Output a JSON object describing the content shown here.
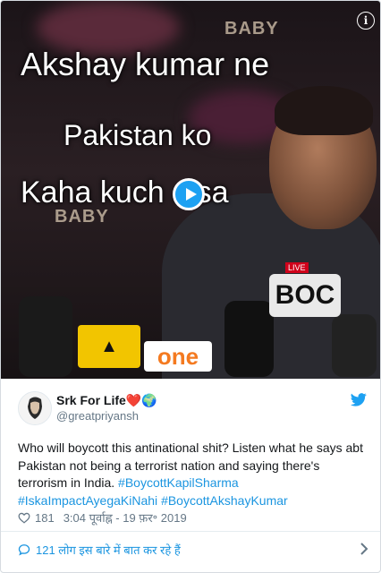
{
  "media": {
    "overlay_lines": [
      "Akshay kumar ne",
      "Pakistan ko",
      "Kaha kuch aisa"
    ],
    "background_labels": [
      "BABY",
      "BABY"
    ],
    "mic_labels": {
      "boc_live": "LIVE",
      "boc": "BOC",
      "one": "one"
    },
    "info_icon": "info-icon",
    "play_icon": "play-icon"
  },
  "author": {
    "name": "Srk For Life❤️🌍",
    "handle": "@greatpriyansh",
    "bird_icon": "twitter-bird-icon"
  },
  "tweet": {
    "text_plain": "Who will boycott this antinational shit?  Listen what he says abt Pakistan not being a terrorist nation and saying there's terrorism in India.",
    "hashtags": [
      "#BoycottKapilSharma",
      "#IskaImpactAyegaKiNahi",
      "#BoycottAkshayKumar"
    ]
  },
  "meta": {
    "likes": "181",
    "timestamp": "3:04 पूर्वाह्न - 19 फ़र॰ 2019"
  },
  "footer": {
    "conversation_label": "121 लोग इस बारे में बात कर रहे हैं"
  },
  "colors": {
    "accent": "#1b95e0",
    "twitter_blue": "#1da1f2",
    "text": "#14171a",
    "muted": "#657786"
  }
}
